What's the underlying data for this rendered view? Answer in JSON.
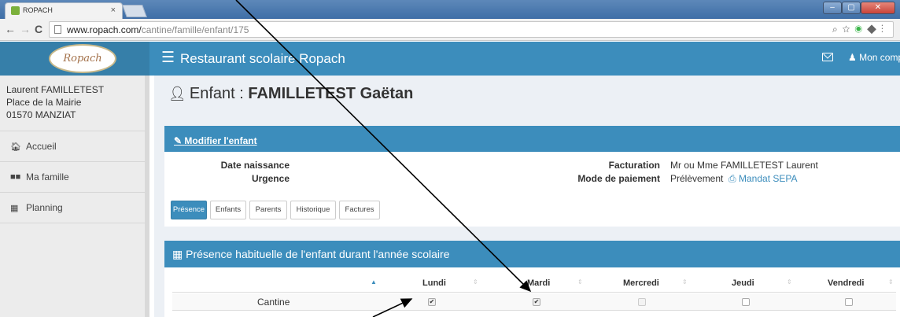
{
  "browser": {
    "tab_title": "ROPACH",
    "tab_close": "×",
    "url_host": "www.ropach.com/",
    "url_path": "cantine/famille/enfant/175"
  },
  "header": {
    "logo_text": "Ropach",
    "menu_icon": "hamburger-icon",
    "title": "Restaurant scolaire Ropach",
    "account_label": "Mon compte",
    "header_color": "#3c8dbc"
  },
  "sidebar": {
    "user_name": "Laurent FAMILLETEST",
    "address_line1": "Place de la Mairie",
    "address_line2": "01570 MANZIAT",
    "items": [
      {
        "label": "Accueil",
        "icon": "home-icon"
      },
      {
        "label": "Ma famille",
        "icon": "group-icon"
      },
      {
        "label": "Planning",
        "icon": "calendar-icon"
      }
    ]
  },
  "page": {
    "title_prefix": "Enfant : ",
    "title_name": "FAMILLETEST Gaëtan"
  },
  "child_box": {
    "edit_label": "Modifier l'enfant",
    "birth_label": "Date naissance",
    "urgency_label": "Urgence",
    "billing_label": "Facturation",
    "billing_value": "Mr ou Mme FAMILLETEST Laurent",
    "payment_label": "Mode de paiement",
    "payment_value": "Prélèvement",
    "mandate_label": "Mandat SEPA",
    "tabs": [
      "Présence",
      "Enfants",
      "Parents",
      "Historique",
      "Factures"
    ],
    "active_tab": "Présence"
  },
  "presence_box": {
    "title": "Présence habituelle de l'enfant durant l'année scolaire",
    "columns": [
      "Lundi",
      "Mardi",
      "Mercredi",
      "Jeudi",
      "Vendredi"
    ],
    "rows": [
      {
        "label": "Cantine",
        "checked": [
          true,
          true,
          false,
          false,
          false
        ],
        "disabled": [
          false,
          false,
          true,
          false,
          false
        ]
      }
    ]
  }
}
